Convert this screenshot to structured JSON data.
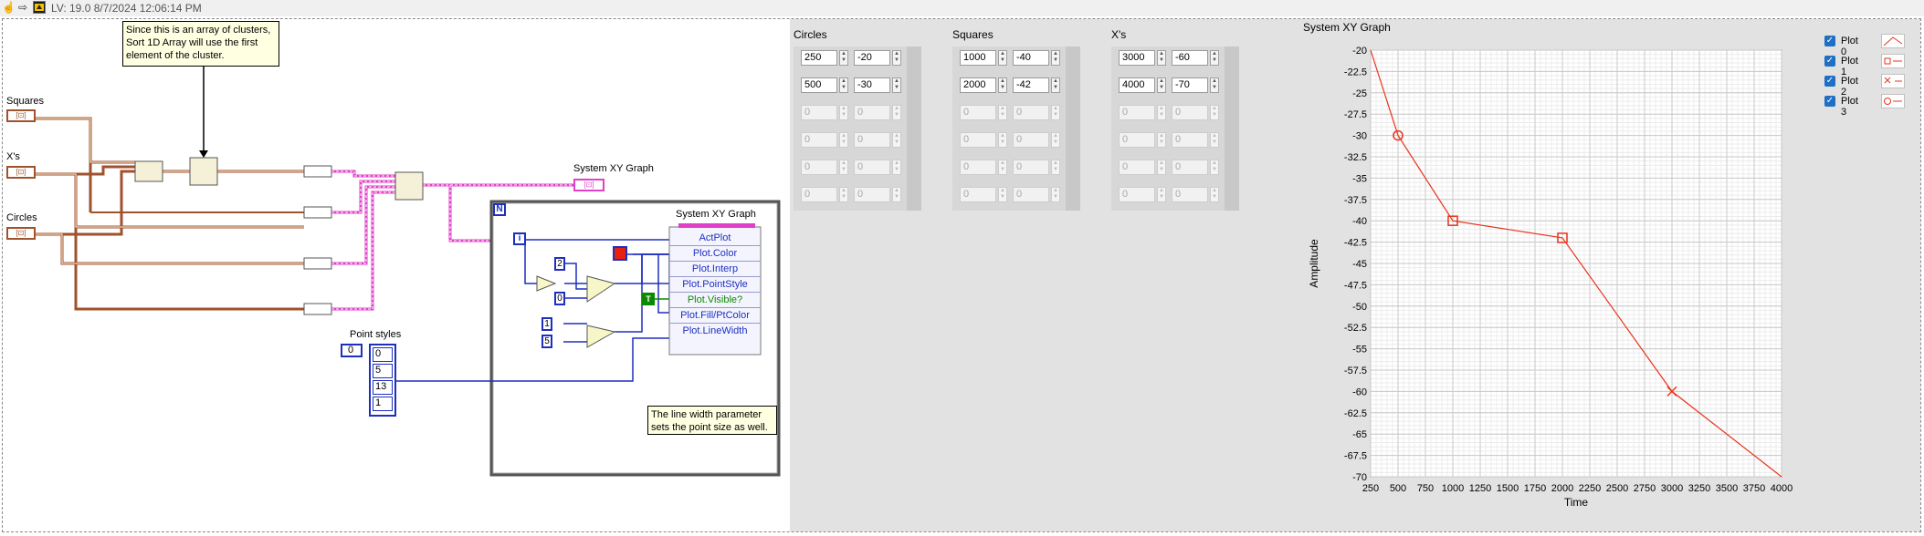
{
  "toolbar": {
    "icons": [
      "hand-icon",
      "run-arrow-icon",
      "labview-icon"
    ],
    "hand_glyph": "☝",
    "arrow_glyph": "⇨",
    "title": "LV: 19.0 8/7/2024 12:06:14 PM"
  },
  "block_diagram": {
    "note_top": [
      "Since this is an array of clusters,",
      "Sort 1D Array will use the first",
      "element of the cluster."
    ],
    "note_bottom": [
      "The line width parameter",
      "sets the point size as well."
    ],
    "terminals": {
      "squares": "Squares",
      "xs": "X's",
      "circles": "Circles",
      "terminal_glyph": "[⊡]"
    },
    "graph_terminal_label": "System XY Graph",
    "point_styles": {
      "label": "Point styles",
      "index": "0",
      "values": [
        "0",
        "5",
        "13",
        "1"
      ]
    },
    "loop": {
      "count_symbol": "N",
      "iteration_symbol": "i",
      "const_2": "2",
      "const_0": "0",
      "const_1": "1",
      "const_5": "5",
      "bool_const": "T",
      "property_node": {
        "title": "System XY Graph",
        "properties": [
          "ActPlot",
          "Plot.Color",
          "Plot.Interp",
          "Plot.PointStyle",
          "Plot.Visible?",
          "Plot.Fill/PtColor",
          "Plot.LineWidth"
        ]
      }
    }
  },
  "front_panel": {
    "arrays": [
      {
        "label": "Circles",
        "rows": [
          [
            "250",
            "-20"
          ],
          [
            "500",
            "-30"
          ],
          [
            "0",
            "0"
          ],
          [
            "0",
            "0"
          ],
          [
            "0",
            "0"
          ],
          [
            "0",
            "0"
          ]
        ],
        "filled_rows": 2
      },
      {
        "label": "Squares",
        "rows": [
          [
            "1000",
            "-40"
          ],
          [
            "2000",
            "-42"
          ],
          [
            "0",
            "0"
          ],
          [
            "0",
            "0"
          ],
          [
            "0",
            "0"
          ],
          [
            "0",
            "0"
          ]
        ],
        "filled_rows": 2
      },
      {
        "label": "X's",
        "rows": [
          [
            "3000",
            "-60"
          ],
          [
            "4000",
            "-70"
          ],
          [
            "0",
            "0"
          ],
          [
            "0",
            "0"
          ],
          [
            "0",
            "0"
          ],
          [
            "0",
            "0"
          ]
        ],
        "filled_rows": 2
      }
    ],
    "graph": {
      "label": "System XY Graph",
      "legend": [
        {
          "name": "Plot 0",
          "checked": true
        },
        {
          "name": "Plot 1",
          "checked": true
        },
        {
          "name": "Plot 2",
          "checked": true
        },
        {
          "name": "Plot 3",
          "checked": true
        }
      ],
      "check_glyph": "✓"
    }
  },
  "chart_data": {
    "type": "scatter",
    "title": "System XY Graph",
    "xlabel": "Time",
    "ylabel": "Amplitude",
    "xlim": [
      250,
      4000
    ],
    "ylim": [
      -70,
      -20
    ],
    "x_ticks": [
      "250",
      "500",
      "750",
      "1000",
      "1250",
      "1500",
      "1750",
      "2000",
      "2250",
      "2500",
      "2750",
      "3000",
      "3250",
      "3500",
      "3750",
      "4000"
    ],
    "y_ticks": [
      "-20",
      "-22.5",
      "-25",
      "-27.5",
      "-30",
      "-32.5",
      "-35",
      "-37.5",
      "-40",
      "-42.5",
      "-45",
      "-47.5",
      "-50",
      "-52.5",
      "-55",
      "-57.5",
      "-60",
      "-62.5",
      "-65",
      "-67.5",
      "-70"
    ],
    "grid": true,
    "line_color": "#e8331c",
    "series": [
      {
        "x": [
          250,
          500,
          1000,
          2000,
          3000,
          4000
        ],
        "y": [
          -20,
          -30,
          -40,
          -42,
          -60,
          -70
        ]
      }
    ],
    "markers": [
      {
        "x": 500,
        "y": -30,
        "style": "circle"
      },
      {
        "x": 1000,
        "y": -40,
        "style": "square"
      },
      {
        "x": 2000,
        "y": -42,
        "style": "square"
      },
      {
        "x": 3000,
        "y": -60,
        "style": "x"
      }
    ]
  }
}
